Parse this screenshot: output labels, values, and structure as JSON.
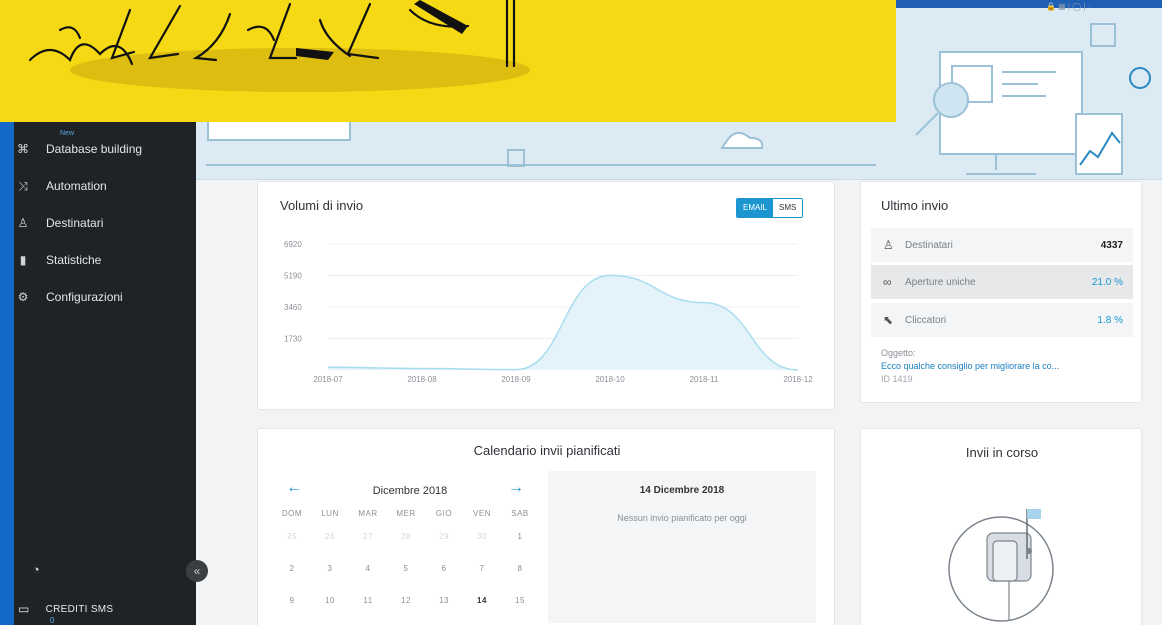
{
  "sidebar": {
    "new_badge": "New",
    "items": [
      {
        "label": "Database building",
        "icon": "database-icon"
      },
      {
        "label": "Automation",
        "icon": "automation-icon"
      },
      {
        "label": "Destinatari",
        "icon": "user-icon"
      },
      {
        "label": "Statistiche",
        "icon": "stats-icon"
      },
      {
        "label": "Configurazioni",
        "icon": "gear-icon"
      }
    ],
    "collapse_label": "«",
    "credits_label": "CREDITI SMS",
    "credits_value": "0"
  },
  "volumi": {
    "title": "Volumi di invio",
    "toggle": {
      "email": "EMAIL",
      "sms": "SMS",
      "active": "email"
    },
    "chart_data": {
      "type": "area",
      "x": [
        "2018-07",
        "2018-08",
        "2018-09",
        "2018-10",
        "2018-11",
        "2018-12"
      ],
      "series": [
        {
          "values": [
            150,
            80,
            20,
            5200,
            3700,
            0
          ]
        }
      ],
      "y_ticks": [
        "6920",
        "5190",
        "3460",
        "1730"
      ],
      "ylim": [
        0,
        6920
      ],
      "grid": true,
      "color": "#a8dcef"
    }
  },
  "ultimo": {
    "title": "Ultimo invio",
    "rows": [
      {
        "label": "Destinatari",
        "value": "4337",
        "icon": "user-icon"
      },
      {
        "label": "Aperture uniche",
        "value": "21.0 %",
        "icon": "glasses-icon"
      },
      {
        "label": "Cliccatori",
        "value": "1.8 %",
        "icon": "cursor-icon"
      }
    ],
    "oggetto_label": "Oggetto:",
    "oggetto_text": "Ecco qualche consiglio per migliorare la co...",
    "oggetto_id": "ID 1419"
  },
  "calendario": {
    "title": "Calendario invii pianificati",
    "month": "Dicembre 2018",
    "days": [
      "DOM",
      "LUN",
      "MAR",
      "MER",
      "GIO",
      "VEN",
      "SAB"
    ],
    "weeks": [
      [
        "25",
        "26",
        "27",
        "28",
        "29",
        "30",
        "1"
      ],
      [
        "2",
        "3",
        "4",
        "5",
        "6",
        "7",
        "8"
      ],
      [
        "9",
        "10",
        "11",
        "12",
        "13",
        "14",
        "15"
      ]
    ],
    "selected_date": "14 Dicembre 2018",
    "empty_message": "Nessun invio pianificato per oggi"
  },
  "invii": {
    "title": "Invii in corso"
  },
  "colors": {
    "accent": "#1b96d1",
    "promo_yellow": "#f5d915",
    "sidebar_bg": "#1f2326"
  }
}
